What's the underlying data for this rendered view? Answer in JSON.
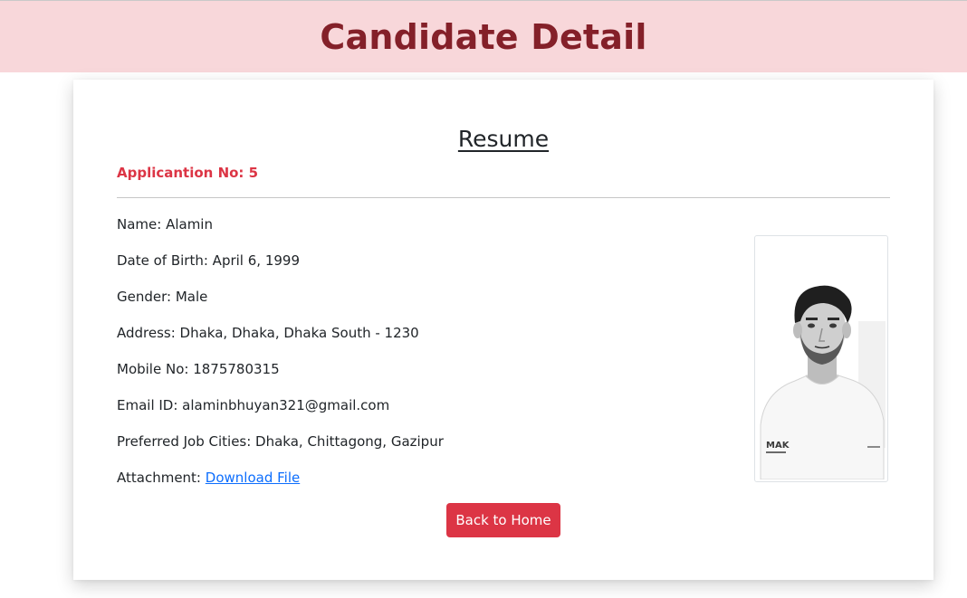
{
  "header": {
    "title": "Candidate Detail"
  },
  "resume": {
    "title": "Resume",
    "application_label": "Applicantion No: 5",
    "fields": {
      "name": "Name: Alamin",
      "dob": "Date of Birth: April 6, 1999",
      "gender": "Gender: Male",
      "address": "Address: Dhaka, Dhaka, Dhaka South - 1230",
      "mobile": "Mobile No: 1875780315",
      "email": "Email ID: alaminbhuyan321@gmail.com",
      "cities": "Preferred Job Cities: Dhaka, Chittagong, Gazipur",
      "attachment_label": "Attachment:",
      "attachment_link": "Download File"
    },
    "photo": {
      "shirt_text": "MAK"
    },
    "back_button": "Back to Home"
  },
  "colors": {
    "header_bg": "#f8d7da",
    "header_text": "#842029",
    "accent_red": "#dc3545",
    "link_blue": "#0d6efd"
  }
}
